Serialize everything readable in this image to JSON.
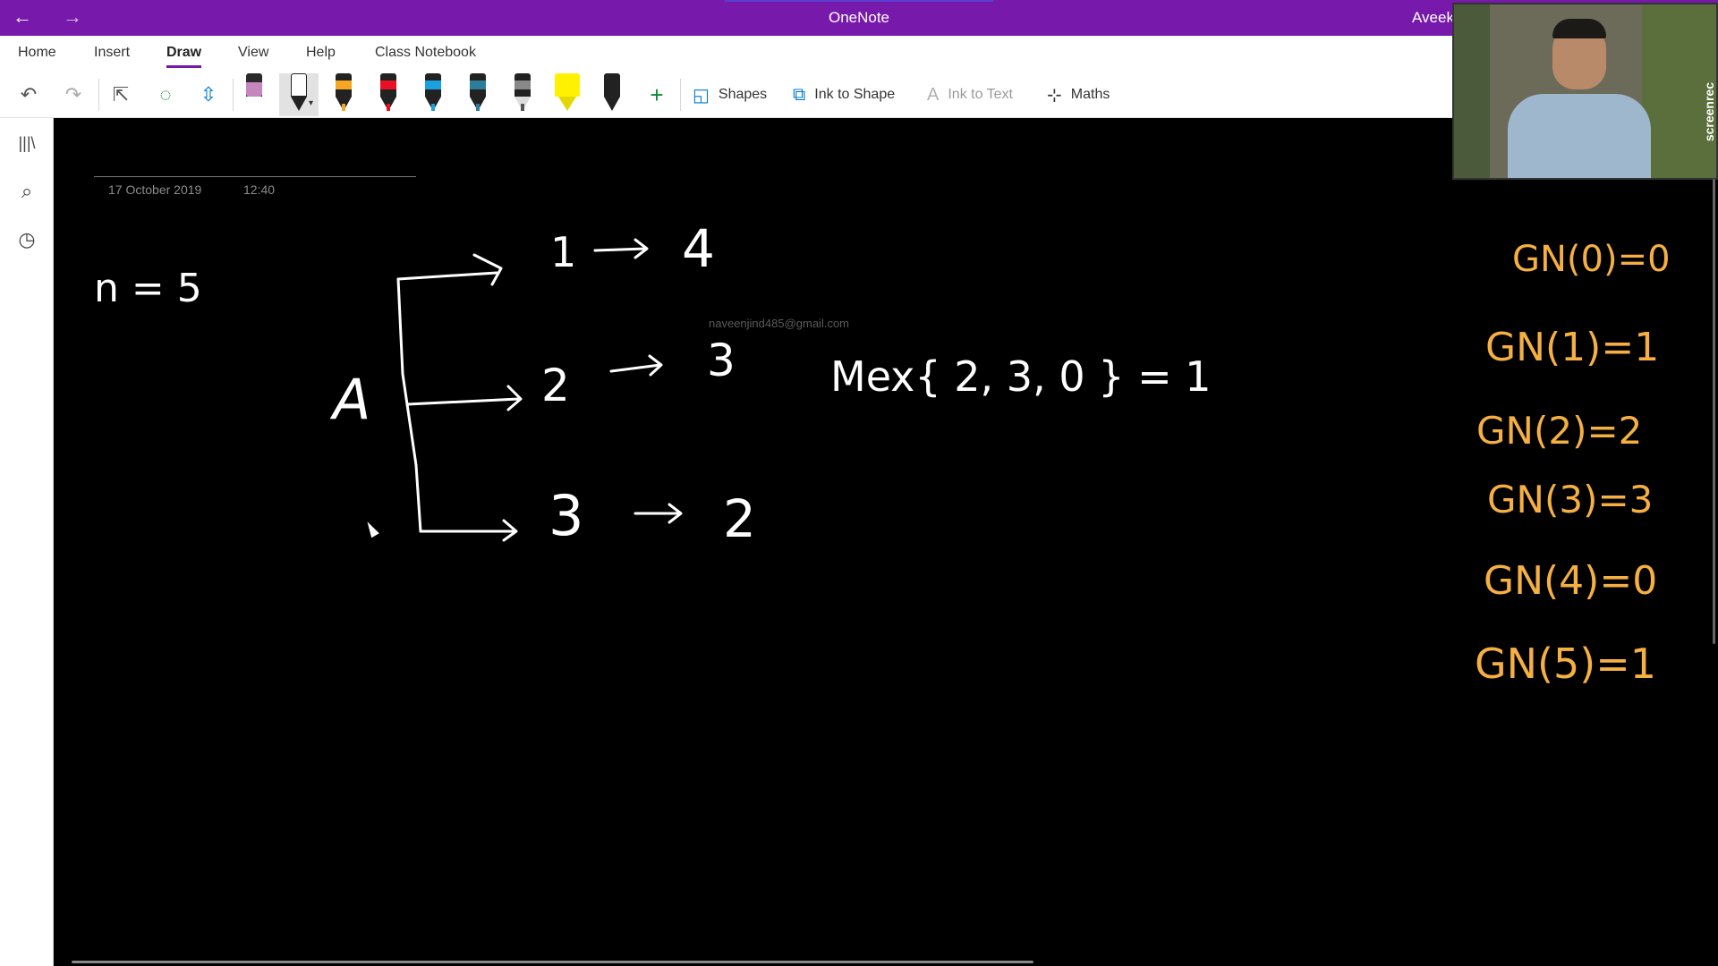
{
  "titlebar": {
    "back_icon": "←",
    "forward_icon": "→",
    "app_title": "OneNote",
    "user_name": "Aveek",
    "accent": "#7719aa"
  },
  "ribbon": {
    "tabs": [
      {
        "label": "Home"
      },
      {
        "label": "Insert"
      },
      {
        "label": "Draw",
        "active": true
      },
      {
        "label": "View"
      },
      {
        "label": "Help"
      },
      {
        "label": "Class Notebook"
      }
    ]
  },
  "toolbar": {
    "undo_icon": "↶",
    "redo_icon": "↷",
    "select_icon": "⇱",
    "lasso_icon": "◌",
    "space_icon": "⇳",
    "add_pen_icon": "+",
    "shapes_label": "Shapes",
    "ink_to_shape_label": "Ink to Shape",
    "ink_to_text_label": "Ink to Text",
    "maths_label": "Maths",
    "pens": [
      {
        "name": "eraser",
        "color": "#c586c0"
      },
      {
        "name": "black-pen-selected",
        "color": "#222222"
      },
      {
        "name": "orange-pen",
        "color": "#f5a623"
      },
      {
        "name": "red-pen",
        "color": "#e81123"
      },
      {
        "name": "blue-pen",
        "color": "#1ba1e2"
      },
      {
        "name": "teal-pen",
        "color": "#2d7d9a"
      },
      {
        "name": "pencil",
        "color": "#555555"
      },
      {
        "name": "yellow-highlighter",
        "color": "#fff100"
      },
      {
        "name": "black-marker",
        "color": "#111111"
      }
    ]
  },
  "sidebar": {
    "notebooks_icon": "|||\\",
    "search_icon": "⌕",
    "recent_icon": "◷"
  },
  "note": {
    "date": "17 October 2019",
    "time": "12:40",
    "watermark": "naveenjind485@gmail.com"
  },
  "ink_white": {
    "n_eq": "n = 5",
    "a_label": "A",
    "branch1_from": "1",
    "branch1_to": "4",
    "branch2_from": "2",
    "branch2_to": "3",
    "branch3_from": "3",
    "branch3_to": "2",
    "mex": "Mex{ 2, 3, 0 } = 1"
  },
  "ink_orange": {
    "gn0": "GN(0)=0",
    "gn1": "GN(1)=1",
    "gn2": "GN(2)=2",
    "gn3": "GN(3)=3",
    "gn4": "GN(4)=0",
    "gn5": "GN(5)=1"
  },
  "overlay": {
    "screenrec_logo": "screenrec"
  },
  "colors": {
    "ink_white": "#ffffff",
    "ink_orange": "#f5b041",
    "canvas": "#000000"
  }
}
